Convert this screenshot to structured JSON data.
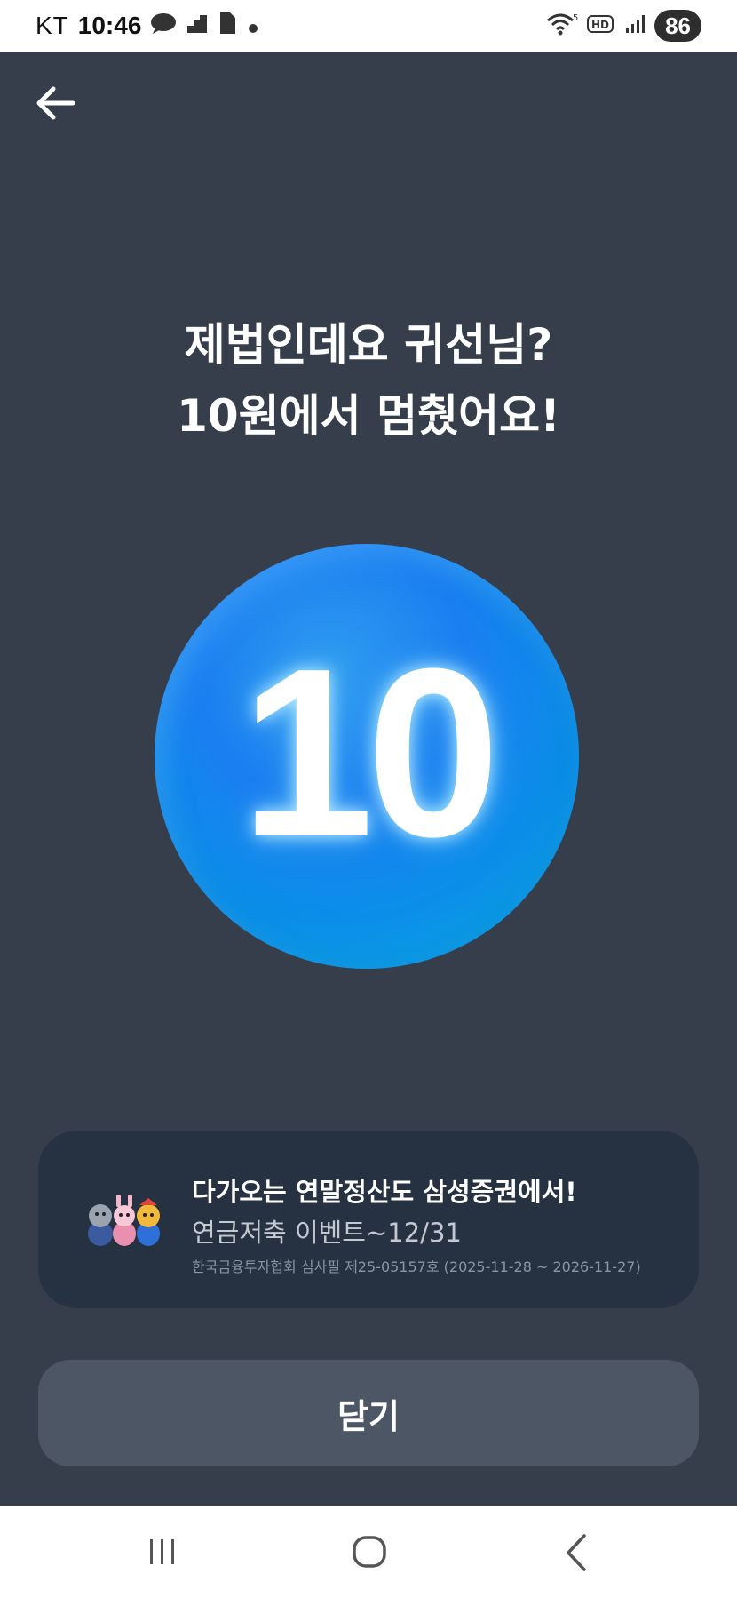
{
  "status_bar": {
    "carrier": "KT",
    "time": "10:46",
    "network": "HD",
    "wifi_badge": "5",
    "battery": "86",
    "icons": [
      "talk-icon",
      "notification-icon",
      "file-icon",
      "dot-icon",
      "wifi-icon",
      "hd-icon",
      "signal-icon",
      "battery-icon"
    ]
  },
  "header": {
    "back_icon": "arrow-left-icon"
  },
  "result": {
    "line1": "제법인데요 귀선님?",
    "line2": "10원에서 멈췄어요!",
    "coin_value": "10"
  },
  "promo": {
    "title": "다가오는 연말정산도 삼성증권에서!",
    "subtitle": "연금저축 이벤트~12/31",
    "note": "한국금융투자협회 심사필 제25-05157호 (2025-11-28 ~ 2026-11-27)",
    "image_icon": "mascot-characters-icon"
  },
  "close_button": {
    "label": "닫기"
  },
  "nav_bar": {
    "recent_icon": "recent-apps-icon",
    "home_icon": "home-icon",
    "back_icon": "back-icon"
  },
  "colors": {
    "background": "#363e4c",
    "coin": "#1a7ff0",
    "promo_bg": "#263142",
    "button_bg": "#4d5665"
  }
}
